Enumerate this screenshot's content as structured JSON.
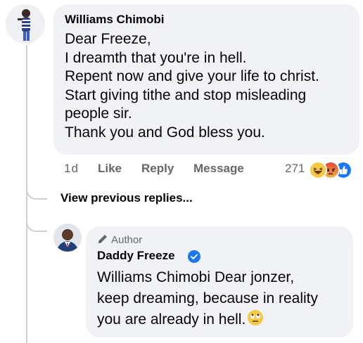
{
  "comment": {
    "author": "Williams Chimobi",
    "lines": [
      "Dear Freeze,",
      "I dreamth that you're in hell.",
      "Repent now and give your life to christ.",
      "Start giving tithe and stop misleading",
      "people sir.",
      "Thank you and God bless you."
    ],
    "time": "1d",
    "like_label": "Like",
    "reply_label": "Reply",
    "message_label": "Message",
    "reaction_count": "271",
    "reactions": [
      "haha-icon",
      "angry-icon",
      "like-icon"
    ]
  },
  "view_previous_label": "View previous replies...",
  "reply": {
    "badge": "Author",
    "author": "Daddy Freeze",
    "verified_icon": "verified-badge-icon",
    "lines": [
      "Williams Chimobi Dear jonzer,",
      "keep dreaming, because in reality",
      "you are already in hell."
    ],
    "end_emoji": "eye-roll-emoji"
  },
  "colors": {
    "bubble": "#f0f2f5",
    "secondary_text": "#65676b",
    "verified_blue": "#1877f2",
    "thread_line": "#ced0d4"
  }
}
